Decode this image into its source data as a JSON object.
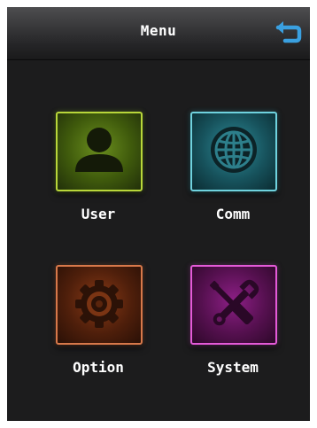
{
  "header": {
    "title": "Menu",
    "back_icon": "back-arrow-icon",
    "back_icon_color": "#3aa0e0"
  },
  "menu": {
    "items": [
      {
        "label": "User",
        "icon": "user-icon",
        "accent": "#b8d63a"
      },
      {
        "label": "Comm",
        "icon": "globe-icon",
        "accent": "#6fd2de"
      },
      {
        "label": "Option",
        "icon": "gear-icon",
        "accent": "#d7784a"
      },
      {
        "label": "System",
        "icon": "tools-icon",
        "accent": "#e45ad8"
      }
    ]
  }
}
